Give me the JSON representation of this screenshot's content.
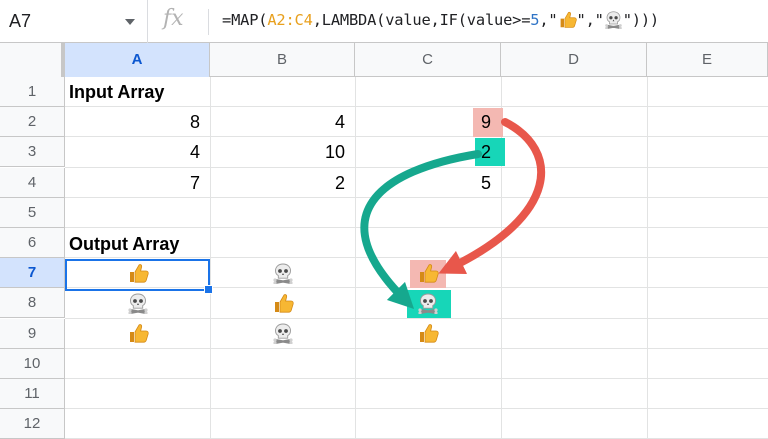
{
  "name_box": {
    "value": "A7"
  },
  "formula_bar": {
    "fx_label": "fx",
    "segments": [
      {
        "text": "=MAP(",
        "type": "plain"
      },
      {
        "text": "A2:C4",
        "type": "ref"
      },
      {
        "text": ",LAMBDA(value,IF(value>=",
        "type": "plain"
      },
      {
        "text": "5",
        "type": "num"
      },
      {
        "text": ",\"",
        "type": "plain"
      },
      {
        "text": "thumbs-up-emoji",
        "type": "emoji"
      },
      {
        "text": "\",\"",
        "type": "plain"
      },
      {
        "text": "skull-crossbones-emoji",
        "type": "emoji"
      },
      {
        "text": "\")))",
        "type": "plain"
      }
    ]
  },
  "columns": [
    "A",
    "B",
    "C",
    "D",
    "E"
  ],
  "active_column": "A",
  "rows": [
    "1",
    "2",
    "3",
    "4",
    "5",
    "6",
    "7",
    "8",
    "9",
    "10",
    "11",
    "12"
  ],
  "active_row": "7",
  "labels": {
    "input": "Input Array",
    "output": "Output Array"
  },
  "input_array": [
    [
      "8",
      "4",
      "9"
    ],
    [
      "4",
      "10",
      "2"
    ],
    [
      "7",
      "2",
      "5"
    ]
  ],
  "output_array": [
    [
      "thumbs-up-emoji",
      "skull-crossbones-emoji",
      "thumbs-up-emoji"
    ],
    [
      "skull-crossbones-emoji",
      "thumbs-up-emoji",
      "skull-crossbones-emoji"
    ],
    [
      "thumbs-up-emoji",
      "skull-crossbones-emoji",
      "thumbs-up-emoji"
    ]
  ],
  "colors": {
    "highlight_red": "#f4b8b2",
    "highlight_green": "#17d6b8",
    "arrow_red": "#e8574b",
    "arrow_green": "#16a88e",
    "selection": "#1a73e8"
  }
}
